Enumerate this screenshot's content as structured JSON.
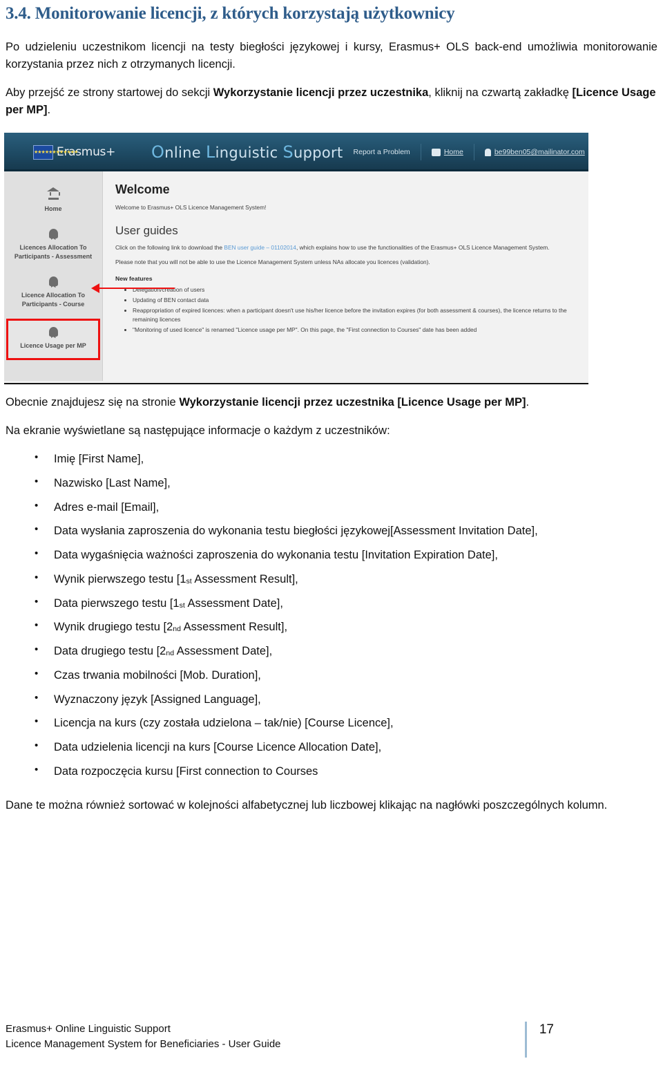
{
  "heading": "3.4. Monitorowanie licencji, z których korzystają użytkownicy",
  "paragraphs": {
    "intro": "Po udzieleniu uczestnikom licencji na testy biegłości językowej i kursy, Erasmus+ OLS back-end umożliwia monitorowanie korzystania przez nich z otrzymanych licencji.",
    "navigate_pre": "Aby przejść ze strony startowej do sekcji ",
    "navigate_bold": "Wykorzystanie licencji przez uczestnika",
    "navigate_mid": ", kliknij na czwartą zakładkę ",
    "navigate_bold2": "[Licence Usage per MP]",
    "navigate_end": ".",
    "current_pre": "Obecnie znajdujesz się na stronie ",
    "current_bold": "Wykorzystanie licencji przez uczestnika [Licence Usage per MP]",
    "current_end": ".",
    "list_lead": "Na ekranie wyświetlane są następujące informacje o każdym z uczestników:",
    "closing": "Dane te można również sortować w kolejności alfabetycznej lub liczbowej klikając na nagłówki poszczególnych kolumn."
  },
  "info_list": [
    {
      "label": "Imię [First Name],"
    },
    {
      "label": "Nazwisko [Last Name],"
    },
    {
      "label": "Adres e-mail [Email],"
    },
    {
      "label": "Data wysłania zaproszenia do wykonania testu biegłości językowej[Assessment Invitation Date],"
    },
    {
      "label": "Data wygaśnięcia ważności zaproszenia do wykonania testu [Invitation Expiration Date],"
    },
    {
      "pre": "Wynik pierwszego testu [1",
      "sup": "st",
      "post": " Assessment Result],"
    },
    {
      "pre": "Data pierwszego testu [1",
      "sup": "st",
      "post": " Assessment Date],"
    },
    {
      "pre": "Wynik drugiego testu [2",
      "sup": "nd",
      "post": " Assessment Result],"
    },
    {
      "pre": "Data drugiego testu [2",
      "sup": "nd",
      "post": " Assessment Date],"
    },
    {
      "label": "Czas trwania mobilności [Mob. Duration],"
    },
    {
      "label": "Wyznaczony język [Assigned Language],"
    },
    {
      "label": "Licencja na kurs (czy została udzielona – tak/nie) [Course Licence],"
    },
    {
      "label": "Data udzielenia licencji na kurs [Course Licence Allocation Date],"
    },
    {
      "label": "Data rozpoczęcia kursu [First connection to Courses"
    }
  ],
  "screenshot": {
    "topbar": {
      "brand": "Erasmus+",
      "title_parts": [
        {
          "cap": "O",
          "rest": "nline "
        },
        {
          "cap": "L",
          "rest": "inguistic "
        },
        {
          "cap": "S",
          "rest": "upport"
        }
      ],
      "links": [
        {
          "label": "Report a Problem",
          "icon": null
        },
        {
          "label": "Home",
          "icon": "home-icon"
        },
        {
          "label": "be99ben05@mailinator.com",
          "icon": "user-icon"
        }
      ],
      "logout_label": "logout-icon"
    },
    "sidebar": [
      {
        "label": "Home",
        "icon": "home-icon",
        "selected": false
      },
      {
        "label": "Licences Allocation To Participants - Assessment",
        "icon": "badge-icon",
        "selected": false
      },
      {
        "label": "Licence Allocation To Participants - Course",
        "icon": "badge-icon",
        "selected": false
      },
      {
        "label": "Licence Usage per MP",
        "icon": "badge-icon",
        "selected": true
      }
    ],
    "main": {
      "welcome_title": "Welcome",
      "welcome_text": "Welcome to Erasmus+ OLS Licence Management System!",
      "guides_title": "User guides",
      "guides_pre": "Click on the following link to download the ",
      "guides_link": "BEN user guide – 01102014",
      "guides_post": ", which explains how to use the functionalities of the Erasmus+ OLS Licence Management System.",
      "note": "Please note that you will not be able to use the Licence Management System unless NAs allocate you licences (validation).",
      "new_features_title": "New features",
      "new_features": [
        "Delegation/creation of users",
        "Updating of BEN contact data",
        "Reappropriation of expired licences: when a participant doesn't use his/her licence before the invitation expires (for both assessment & courses), the licence returns to the remaining licences",
        "\"Monitoring of used licence\" is renamed \"Licence usage per MP\".  On this page, the \"First connection to Courses\" date has been added"
      ]
    }
  },
  "footer": {
    "line1": "Erasmus+ Online Linguistic Support",
    "line2": "Licence Management System for Beneficiaries - User Guide",
    "page_number": "17"
  },
  "colors": {
    "heading": "#2E5C8A",
    "annotation": "#EE1111",
    "link": "#5B9BD5",
    "footer_rule": "#9DBCD4"
  }
}
